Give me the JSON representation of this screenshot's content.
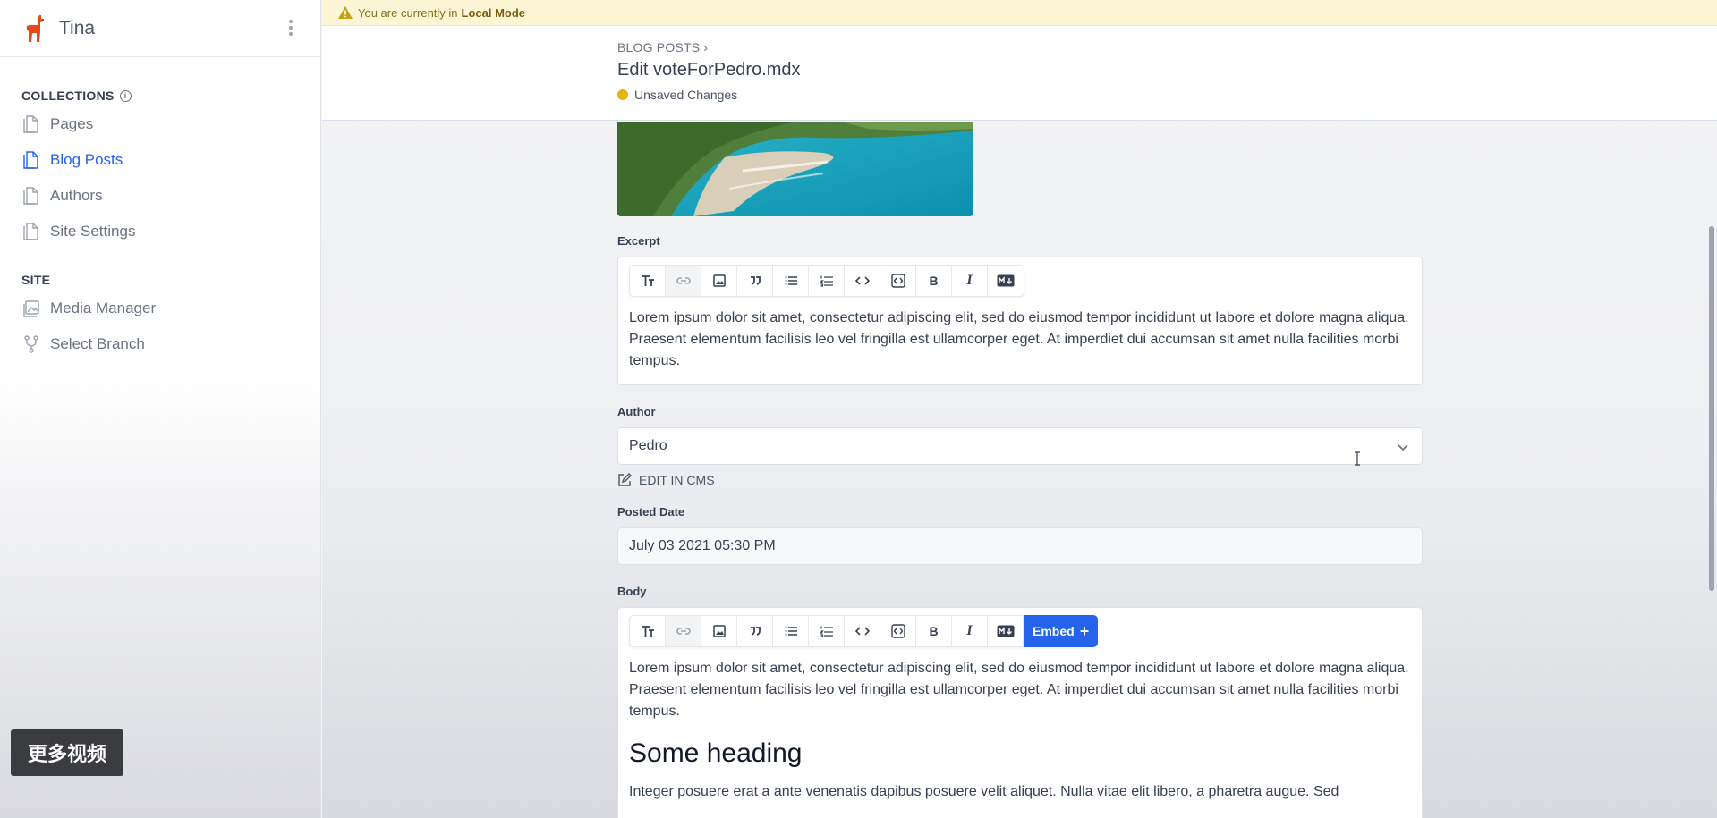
{
  "sidebar": {
    "app_name": "Tina",
    "collections_title": "COLLECTIONS",
    "collections": [
      {
        "label": "Pages",
        "icon": "document-icon",
        "active": false
      },
      {
        "label": "Blog Posts",
        "icon": "document-icon",
        "active": true
      },
      {
        "label": "Authors",
        "icon": "document-icon",
        "active": false
      },
      {
        "label": "Site Settings",
        "icon": "document-icon",
        "active": false
      }
    ],
    "site_title": "SITE",
    "site_items": [
      {
        "label": "Media Manager",
        "icon": "image-icon"
      },
      {
        "label": "Select Branch",
        "icon": "git-branch-icon"
      }
    ]
  },
  "watermark": "更多视频",
  "banner": {
    "text": "You are currently in",
    "mode": "Local Mode"
  },
  "header": {
    "breadcrumb": "BLOG POSTS",
    "title": "Edit voteForPedro.mdx",
    "status": "Unsaved Changes"
  },
  "form": {
    "excerpt_label": "Excerpt",
    "excerpt_text": "Lorem ipsum dolor sit amet, consectetur adipiscing elit, sed do eiusmod tempor incididunt ut labore et dolore magna aliqua. Praesent elementum facilisis leo vel fringilla est ullamcorper eget. At imperdiet dui accumsan sit amet nulla facilities morbi tempus.",
    "author_label": "Author",
    "author_value": "Pedro",
    "edit_in_cms": "EDIT IN CMS",
    "posted_date_label": "Posted Date",
    "posted_date_value": "July 03 2021 05:30 PM",
    "body_label": "Body",
    "body_paragraph": "Lorem ipsum dolor sit amet, consectetur adipiscing elit, sed do eiusmod tempor incididunt ut labore et dolore magna aliqua. Praesent elementum facilisis leo vel fringilla est ullamcorper eget. At imperdiet dui accumsan sit amet nulla facilities morbi tempus.",
    "body_heading": "Some heading",
    "body_paragraph_2": "Integer posuere erat a ante venenatis dapibus posuere velit aliquet. Nulla vitae elit libero, a pharetra augue. Sed",
    "embed_label": "Embed"
  },
  "toolbar": {
    "bold": "B",
    "italic": "I",
    "markdown": "M↓"
  },
  "colors": {
    "accent": "#2563eb",
    "status_dot": "#eab308",
    "banner_bg": "#fcf6d5"
  }
}
